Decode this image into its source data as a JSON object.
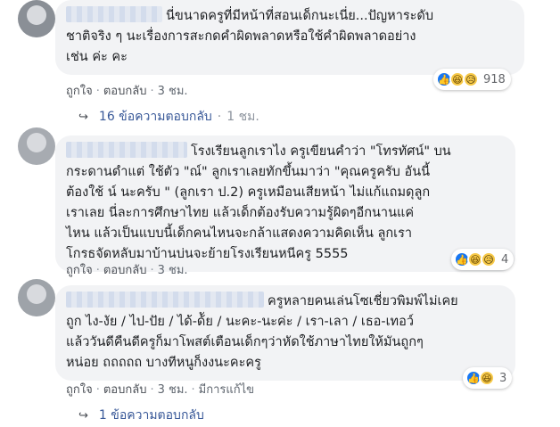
{
  "comments": [
    {
      "lines": [
        "นี่ขนาดครูที่มีหน้าที่สอนเด็กนะเนี่ย...ปัญหาระดับ",
        "ชาติจริง ๆ นะเรื่องการสะกดคำผิดพลาดหรือใช้คำผิดพลาดอย่าง",
        "เช่น ค่ะ คะ"
      ],
      "reaction_count": "918",
      "like_label": "ถูกใจ",
      "reply_label": "ตอบกลับ",
      "time": "3 ชม.",
      "replies": {
        "count_label": "16 ข้อความตอบกลับ",
        "time": "1 ชม."
      }
    },
    {
      "lines": [
        "โรงเรียนลูกเราไง ครูเขียนคำว่า \"โทรทัศน์\" บน",
        "กระดานดำแต่ ใช้ตัว \"ณ์\" ลูกเราเลยทักขึ้นมาว่า \"คุณครูครับ อันนี้",
        "ต้องใช้ น์ นะครับ \" (ลูกเรา ป.2) ครูเหมือนเสียหน้า ไม่แก้แถมดุลูก",
        "เราเลย นี่ละการศึกษาไทย แล้วเด็กต้องรับความรู้ผิดๆอีกนานแค่",
        "ไหน แล้วเป็นแบบนี้เด็กคนไหนจะกล้าแสดงความคิดเห็น ลูกเรา",
        "โกรธจัดหลับมาบ้านบ่นจะย้ายโรงเรียนหนีครู 5555"
      ],
      "reaction_count": "4",
      "like_label": "ถูกใจ",
      "reply_label": "ตอบกลับ",
      "time": "3 ชม."
    },
    {
      "lines": [
        "ครูหลายคนเล่นโซเชี่ยวพิมพ์ไม่เคย",
        "ถูก ไง-งัย / ไป-ปัย / ได้-ด้ัย / นะคะ-นะค่ะ / เรา-เลา / เธอ-เทอว์",
        "แล้ววันดีคืนดีครูก็มาโพสต์เตือนเด็กๆว่าหัดใช้ภาษาไทยให้มันถูกๆ",
        "หน่อย ถถถถถ บางทีหนูก็งงนะคะครู"
      ],
      "reaction_count": "3",
      "like_label": "ถูกใจ",
      "reply_label": "ตอบกลับ",
      "time": "3 ชม.",
      "edited_label": "มีการแก้ไข",
      "replies": {
        "count_label": "1 ข้อความตอบกลับ"
      }
    }
  ],
  "icons": {
    "like": "like-icon",
    "haha": "haha-icon",
    "sad": "sad-icon",
    "reply_arrow": "reply-arrow-icon"
  },
  "colors": {
    "bubble": "#f2f3f5",
    "like_blue": "#1877f2",
    "link_blue": "#385898",
    "meta_gray": "#606770"
  }
}
